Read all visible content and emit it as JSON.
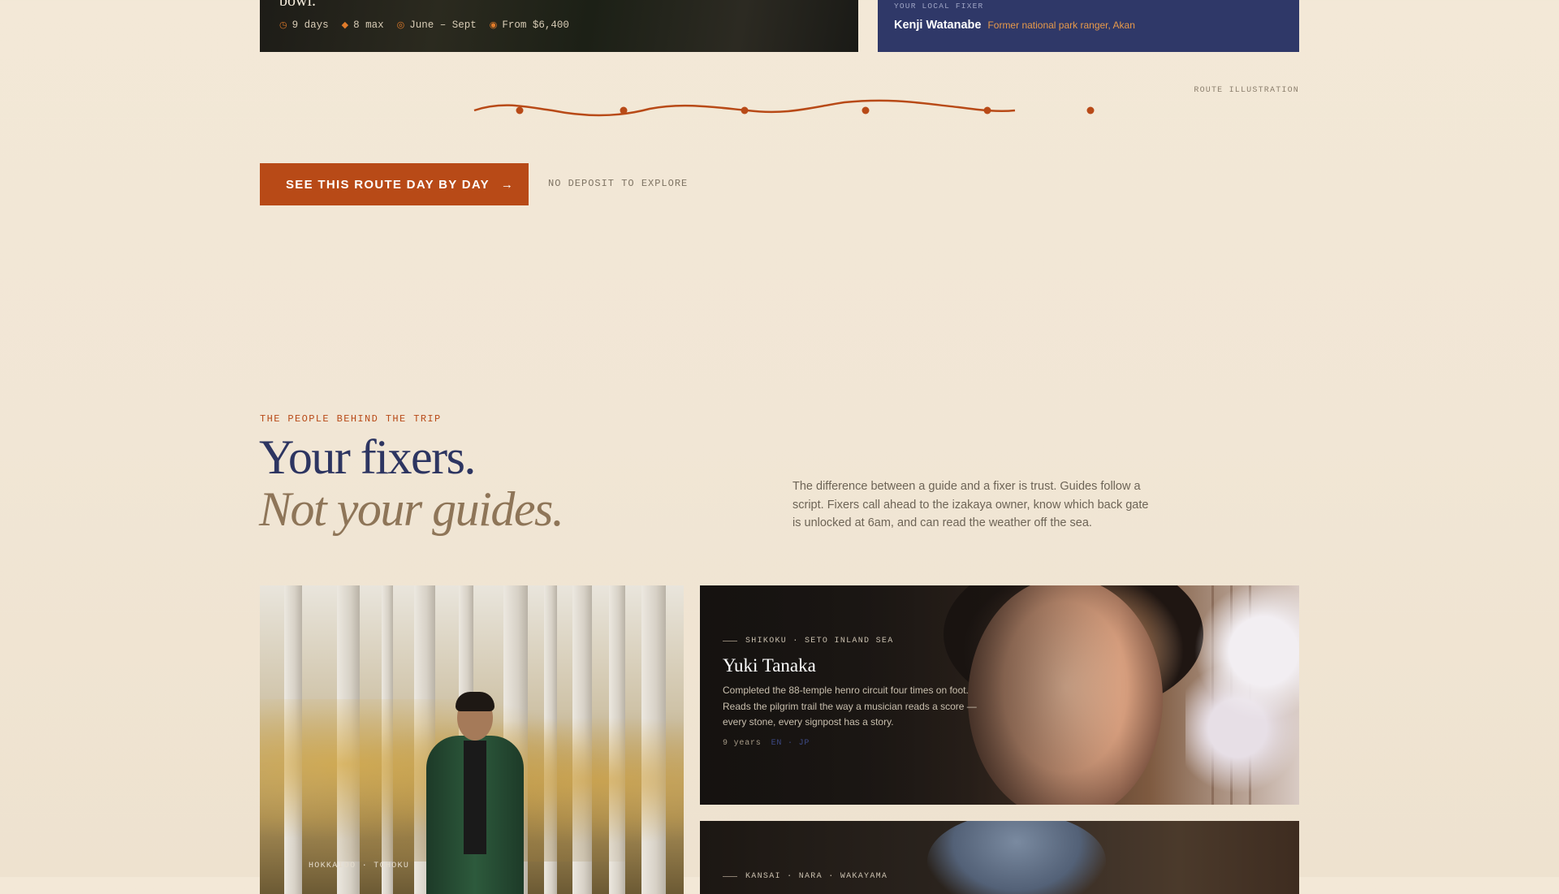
{
  "tour": {
    "title_fragment": "bowl.",
    "meta": [
      {
        "icon": "clock-icon",
        "glyph": "◷",
        "text": "9 days"
      },
      {
        "icon": "group-icon",
        "glyph": "◆",
        "text": "8 max"
      },
      {
        "icon": "calendar-icon",
        "glyph": "◎",
        "text": "June – Sept"
      },
      {
        "icon": "price-icon",
        "glyph": "◉",
        "text": "From $6,400"
      }
    ]
  },
  "fixer": {
    "eyebrow": "YOUR LOCAL FIXER",
    "name": "Kenji Watanabe",
    "role": "Former national park ranger, Akan"
  },
  "route": {
    "label": "ROUTE ILLUSTRATION",
    "stops": 6,
    "color": "#b84a17"
  },
  "cta": {
    "label": "SEE THIS ROUTE DAY BY DAY",
    "arrow": "→",
    "note": "NO DEPOSIT TO EXPLORE"
  },
  "section": {
    "eyebrow": "THE PEOPLE BEHIND THE TRIP",
    "heading_line1": "Your fixers.",
    "heading_line2": "Not your guides.",
    "intro": "The difference between a guide and a fixer is trust. Guides follow a script. Fixers call ahead to the izakaya owner, know which back gate is unlocked at 6am, and can read the weather off the sea."
  },
  "fixers": [
    {
      "region": "HOKKAIDO · TOHOKU"
    },
    {
      "region": "SHIKOKU · SETO INLAND SEA",
      "name": "Yuki Tanaka",
      "bio": "Completed the 88-temple henro circuit four times on foot. Reads the pilgrim trail the way a musician reads a score — every stone, every signpost has a story.",
      "years": "9 years",
      "languages": "EN · JP"
    },
    {
      "region": "KANSAI · NARA · WAKAYAMA"
    }
  ],
  "colors": {
    "accent": "#b84a17",
    "navy": "#2d3561",
    "background": "#f2e7d6"
  }
}
